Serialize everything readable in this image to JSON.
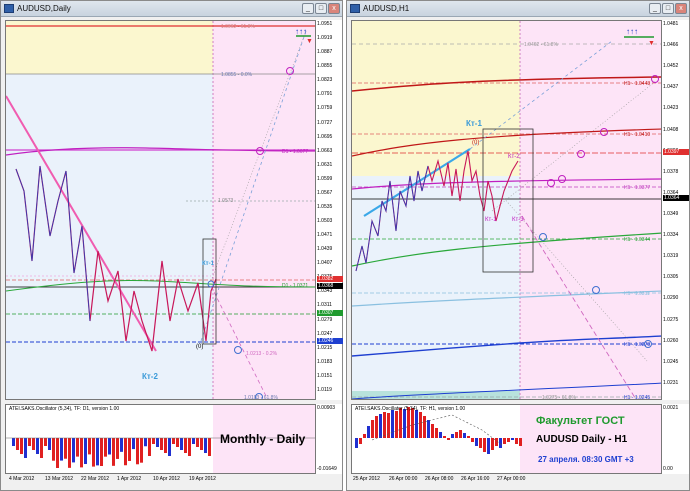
{
  "left_window": {
    "title": "AUDUSD,Daily",
    "buttons": [
      "_",
      "□",
      "x"
    ],
    "price_labels": [
      {
        "text": "1.0951"
      },
      {
        "text": "1.0919"
      },
      {
        "text": "1.0887"
      },
      {
        "text": "1.0855"
      },
      {
        "text": "1.0823"
      },
      {
        "text": "1.0791"
      },
      {
        "text": "1.0759"
      },
      {
        "text": "1.0727"
      },
      {
        "text": "1.0695"
      },
      {
        "text": "1.0663"
      },
      {
        "text": "1.0631"
      },
      {
        "text": "1.0599"
      },
      {
        "text": "1.0567"
      },
      {
        "text": "1.0535"
      },
      {
        "text": "1.0503"
      },
      {
        "text": "1.0471"
      },
      {
        "text": "1.0439"
      },
      {
        "text": "1.0407"
      },
      {
        "text": "1.0375"
      },
      {
        "text": "1.0343"
      },
      {
        "text": "1.0311"
      },
      {
        "text": "1.0279"
      },
      {
        "text": "1.0247"
      },
      {
        "text": "1.0215"
      },
      {
        "text": "1.0183"
      },
      {
        "text": "1.0151"
      },
      {
        "text": "1.0119"
      }
    ],
    "boxed_labels": [
      {
        "text": "1.0382",
        "color": "#e03030"
      },
      {
        "text": "1.0368",
        "color": "#000000"
      },
      {
        "text": "1.0307",
        "color": "#1f9a2e"
      },
      {
        "text": "1.0246",
        "color": "#1e3fd0"
      }
    ],
    "level_labels": [
      {
        "text": "1.0962 - 61.8%"
      },
      {
        "text": "1.0855 - 0.0%"
      },
      {
        "text": "D1 - 1.0677"
      },
      {
        "text": "1.0573"
      },
      {
        "text": "D1 - 1.0371"
      },
      {
        "text": "1.0213 - 0.2%"
      },
      {
        "text": "1.0103 - 61.8%"
      }
    ],
    "annotations": {
      "kt1": "Кт-1",
      "kt2": "Кт-2",
      "zero": "(0)",
      "b": "(b)"
    },
    "indicator": {
      "title": "ATEI.SAKS.Oscillator (5,34), TF: D1, version 1.00",
      "scale_top": "0.00903",
      "scale_bottom": "-0.01649",
      "label": "Monthly - Daily"
    },
    "dates": [
      "4 Mar 2012",
      "13 Mar 2012",
      "22 Mar 2012",
      "1 Apr 2012",
      "10 Apr 2012",
      "19 Apr 2012"
    ]
  },
  "right_window": {
    "title": "AUDUSD,H1",
    "buttons": [
      "_",
      "□",
      "x"
    ],
    "price_labels": [
      {
        "text": "1.0481"
      },
      {
        "text": "1.0466"
      },
      {
        "text": "1.0452"
      },
      {
        "text": "1.0437"
      },
      {
        "text": "1.0423"
      },
      {
        "text": "1.0408"
      },
      {
        "text": "1.0393"
      },
      {
        "text": "1.0378"
      },
      {
        "text": "1.0364"
      },
      {
        "text": "1.0349"
      },
      {
        "text": "1.0334"
      },
      {
        "text": "1.0319"
      },
      {
        "text": "1.0305"
      },
      {
        "text": "1.0290"
      },
      {
        "text": "1.0275"
      },
      {
        "text": "1.0260"
      },
      {
        "text": "1.0245"
      },
      {
        "text": "1.0231"
      }
    ],
    "boxed_labels": [
      {
        "text": "1.0397",
        "color": "#e03030"
      },
      {
        "text": "1.0364",
        "color": "#000000"
      }
    ],
    "level_labels": [
      {
        "text": "1.0462 - 61.8%"
      },
      {
        "text": "H1 - 1.0443"
      },
      {
        "text": "H1 - 1.0410"
      },
      {
        "text": "H1 - 1.0377"
      },
      {
        "text": "H1 - 1.0344"
      },
      {
        "text": "H1 - 1.0311"
      },
      {
        "text": "H1 - 1.0278"
      },
      {
        "text": "H1 - 1.0245"
      },
      {
        "text": "1.0275 - 61.8%"
      }
    ],
    "annotations": {
      "kt1": "Кт-1",
      "kt2": "Кт-2",
      "kt3": "Кт-3",
      "kt1b": "Кт-1",
      "zero": "(0)"
    },
    "indicator": {
      "title": "ATEI.SAKS.Oscillator (5,34), TF: H1, version 1.00",
      "scale_top": "0.0021",
      "scale_bottom": "0.00"
    },
    "branding": {
      "line1": "Факультет ГОСТ",
      "line2": "AUDUSD Daily - H1",
      "line3": "27 апреля. 08:30 GMT +3"
    },
    "dates": [
      "25 Apr 2012",
      "26 Apr 00:00",
      "26 Apr 08:00",
      "26 Apr 16:00",
      "27 Apr 00:00"
    ]
  },
  "colors": {
    "pale_yellow": "#fbf7cf",
    "pale_pink": "#fde4f7",
    "pale_blue": "#eaf2fb",
    "candle_line": "#c8185a",
    "bar_up": "#e02020",
    "bar_down": "#2030d0"
  }
}
